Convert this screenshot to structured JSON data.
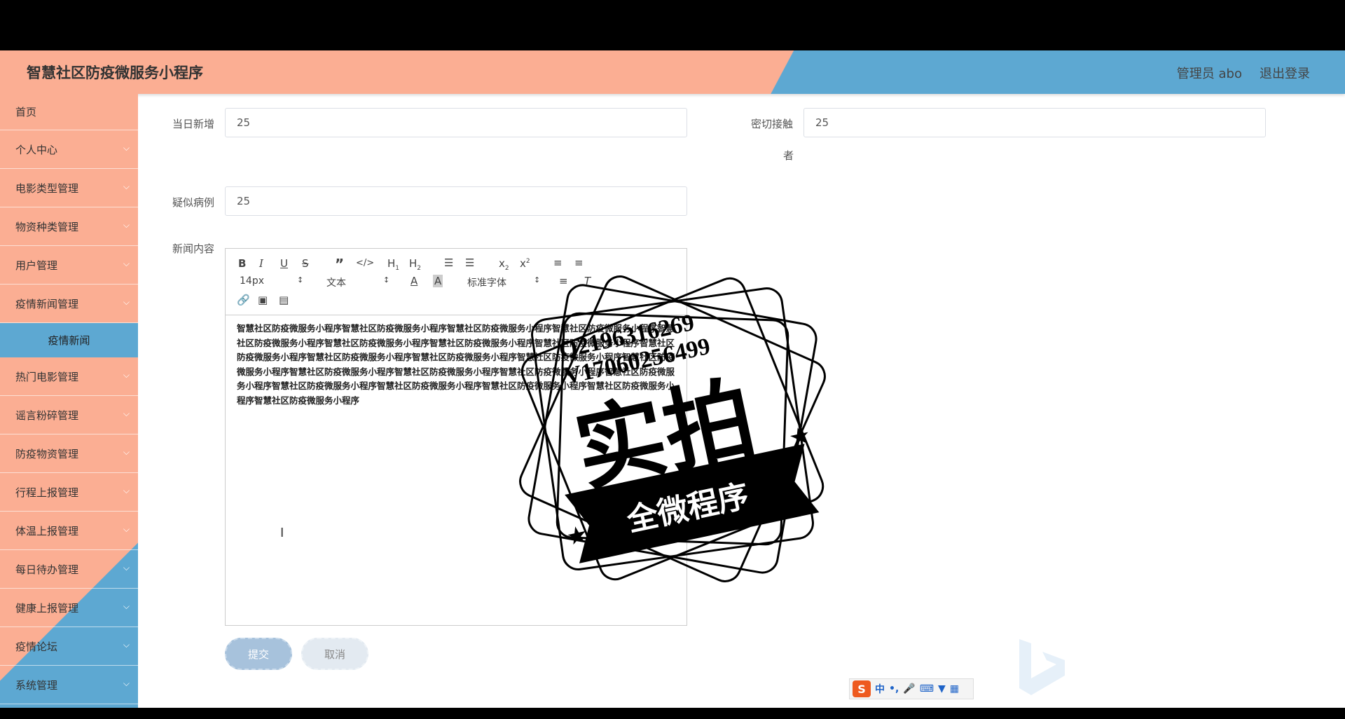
{
  "header": {
    "title": "智慧社区防疫微服务小程序",
    "admin": "管理员 abo",
    "logout": "退出登录"
  },
  "sidebar": {
    "items": [
      {
        "label": "首页"
      },
      {
        "label": "个人中心"
      },
      {
        "label": "电影类型管理"
      },
      {
        "label": "物资种类管理"
      },
      {
        "label": "用户管理"
      },
      {
        "label": "疫情新闻管理"
      },
      {
        "label": "疫情新闻"
      },
      {
        "label": "热门电影管理"
      },
      {
        "label": "谣言粉碎管理"
      },
      {
        "label": "防疫物资管理"
      },
      {
        "label": "行程上报管理"
      },
      {
        "label": "体温上报管理"
      },
      {
        "label": "每日待办管理"
      },
      {
        "label": "健康上报管理"
      },
      {
        "label": "疫情论坛"
      },
      {
        "label": "系统管理"
      }
    ]
  },
  "form": {
    "daily_new": {
      "label": "当日新增",
      "value": "25"
    },
    "close_contact": {
      "label": "密切接触者",
      "label_line1": "密切接触",
      "label_line2": "者",
      "value": "25"
    },
    "suspected": {
      "label": "疑似病例",
      "value": "25"
    },
    "news_content": {
      "label": "新闻内容"
    }
  },
  "editor": {
    "font_size": "14px",
    "paragraph_type": "文本",
    "font_family": "标准字体",
    "content": "智慧社区防疫微服务小程序智慧社区防疫微服务小程序智慧社区防疫微服务小程序智慧社区防疫微服务小程序智慧社区防疫微服务小程序智慧社区防疫微服务小程序智慧社区防疫微服务小程序智慧社区防疫微服务小程序智慧社区防疫微服务小程序智慧社区防疫微服务小程序智慧社区防疫微服务小程序智慧社区防疫微服务小程序智慧社区防疫微服务小程序智慧社区防疫微服务小程序智慧社区防疫微服务小程序智慧社区防疫微服务小程序智慧社区防疫微服务小程序智慧社区防疫微服务小程序智慧社区防疫微服务小程序智慧社区防疫微服务小程序智慧社区防疫微服务小程序智慧社区防疫微服务小程序"
  },
  "buttons": {
    "submit": "提交",
    "cancel": "取消"
  },
  "watermark": {
    "qq": "Q2196316269",
    "wechat": "V17060256499",
    "big": "实拍",
    "ribbon": "全微程序"
  },
  "ime": {
    "logo": "S",
    "lang": "中",
    "punct": "•,"
  },
  "colors": {
    "salmon": "#fbae93",
    "blue": "#5da8d2"
  }
}
